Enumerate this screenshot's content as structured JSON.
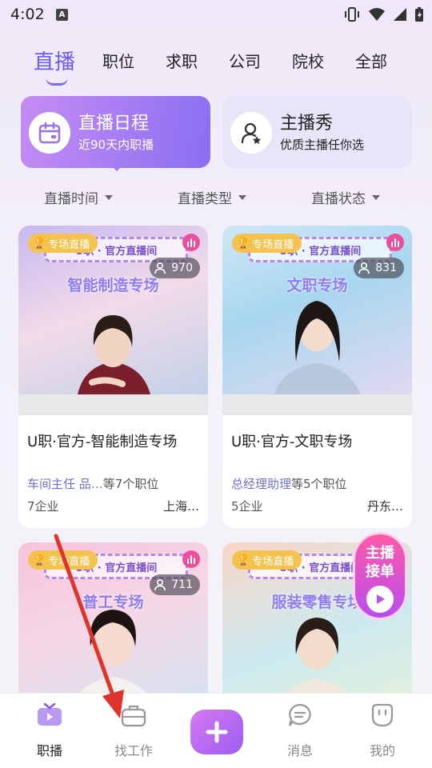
{
  "status_bar": {
    "time": "4:02",
    "notification_letter": "A"
  },
  "top_tabs": [
    {
      "label": "直播",
      "active": true
    },
    {
      "label": "职位"
    },
    {
      "label": "求职"
    },
    {
      "label": "公司"
    },
    {
      "label": "院校"
    },
    {
      "label": "全部"
    }
  ],
  "features": {
    "schedule": {
      "title": "直播日程",
      "subtitle": "近90天内职播"
    },
    "show": {
      "title": "主播秀",
      "subtitle": "优质主播任你选"
    }
  },
  "filters": [
    "直播时间",
    "直播类型",
    "直播状态"
  ],
  "cards": [
    {
      "badge": "专场直播",
      "banner": "U职 · 官方直播间",
      "theme": "智能制造专场",
      "viewers": "970",
      "title": "U职·官方-智能制造专场",
      "jobs_highlight": "车间主任 品…",
      "jobs_rest": "等7个职位",
      "companies": "7企业",
      "location": "上海…"
    },
    {
      "badge": "专场直播",
      "banner": "U职 · 官方直播间",
      "theme": "文职专场",
      "viewers": "831",
      "title": "U职·官方-文职专场",
      "jobs_highlight": "总经理助理",
      "jobs_rest": "等5个职位",
      "companies": "5企业",
      "location": "丹东…"
    },
    {
      "badge": "专场直播",
      "banner": "U职 · 官方直播间",
      "theme": "普工专场",
      "viewers": "711"
    },
    {
      "badge": "专场直播",
      "banner": "U职 · 官方直播间",
      "theme": "服装零售专场"
    }
  ],
  "promo": {
    "line1": "主播",
    "line2": "接单"
  },
  "bottom_nav": [
    {
      "label": "职播",
      "icon": "tv-icon",
      "active": true
    },
    {
      "label": "找工作",
      "icon": "briefcase-icon"
    },
    {
      "label": "消息",
      "icon": "message-icon"
    },
    {
      "label": "我的",
      "icon": "profile-icon"
    }
  ],
  "colors": {
    "accent": "#7a6cf5",
    "live": "#ec4f9a",
    "badge": "#f4c34f",
    "annotation_arrow": "#e0332b"
  }
}
